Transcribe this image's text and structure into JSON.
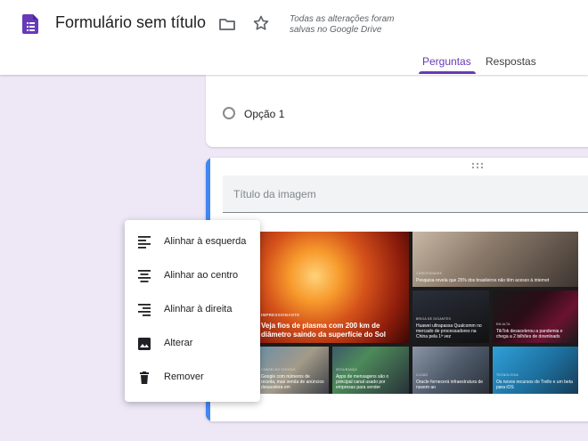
{
  "header": {
    "title": "Formulário sem título",
    "save_status": "Todas as alterações foram salvas no Google Drive",
    "tabs": [
      {
        "label": "Perguntas",
        "active": true
      },
      {
        "label": "Respostas",
        "active": false
      }
    ],
    "accent_color": "#673ab7"
  },
  "question": {
    "option_label": "Opção 1"
  },
  "image_item": {
    "title_placeholder": "Título da imagem",
    "collage": {
      "main_tag": "IMPRESSIONANTE",
      "main_headline": "Veja fios de plasma com 200 km de diâmetro saindo da superfície do Sol",
      "tiles": [
        {
          "tag": "CURIOSIDADES",
          "text": "Pesquisa revela que 25% dos brasileiros não têm acesso à internet"
        },
        {
          "tag": "BRIGA DE GIGANTES",
          "text": "Huawei ultrapassa Qualcomm no mercado de processadores na China pela 1ª vez"
        },
        {
          "tag": "EM ALTA",
          "text": "TikTok desacelerou a pandemia e chega a 2 bilhões de downloads"
        },
        {
          "tag": "CONSELHO GOOGLE",
          "text": "Google com números de receita, mas venda de anúncios desacelera em"
        },
        {
          "tag": "SEGURANÇA",
          "text": "Apps de mensagens são o principal canal usado por empresas para vender"
        },
        {
          "tag": "CLOUD",
          "text": "Oracle fornecerá infraestrutura de nuvem ao"
        },
        {
          "tag": "TECNOLOGIA",
          "text": "Os novos recursos do Trello e um beta para iOS"
        }
      ]
    }
  },
  "context_menu": {
    "items": [
      {
        "label": "Alinhar à esquerda",
        "icon": "align-left-icon"
      },
      {
        "label": "Alinhar ao centro",
        "icon": "align-center-icon"
      },
      {
        "label": "Alinhar à direita",
        "icon": "align-right-icon"
      },
      {
        "label": "Alterar",
        "icon": "image-icon"
      },
      {
        "label": "Remover",
        "icon": "trash-icon"
      }
    ]
  }
}
